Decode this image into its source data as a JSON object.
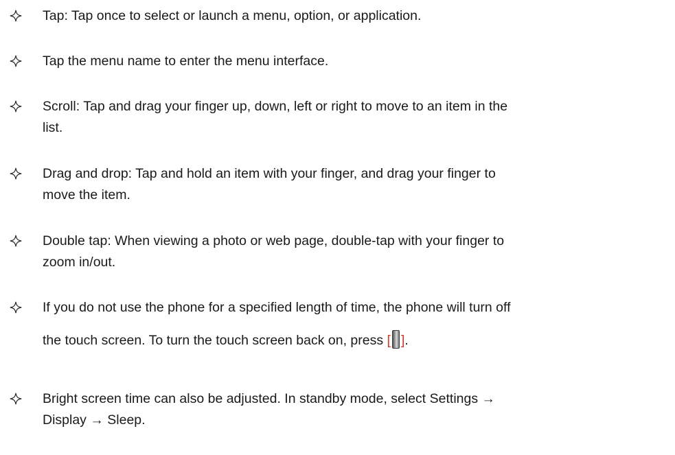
{
  "bullets": [
    {
      "lines": [
        "Tap: Tap once to select or launch a menu, option, or application."
      ]
    },
    {
      "lines": [
        "Tap the menu name to enter the menu interface."
      ]
    },
    {
      "lines": [
        "Scroll: Tap and drag your finger up, down, left or right to move to an item in the",
        "list."
      ]
    },
    {
      "lines": [
        "Drag and drop: Tap and hold an item with your finger, and drag your finger to",
        "move the item."
      ]
    },
    {
      "lines": [
        "Double tap: When viewing a photo or web page, double-tap with your finger to",
        "zoom in/out."
      ]
    },
    {
      "line1": "If you do not use the phone for a specified length of time, the phone will turn off",
      "line2_before": "the touch screen. To turn the touch screen back on, press ",
      "bracket_open": "[",
      "bracket_close": "]",
      "line2_after": "."
    },
    {
      "lines": [
        "Bright screen time can also be adjusted. In standby mode, select Settings →",
        "Display → Sleep."
      ]
    }
  ],
  "icons": {
    "bullet": "four-point-star-outline-icon",
    "key": "power-key-icon"
  },
  "colors": {
    "text": "#1a1a1a",
    "bracket": "#e0301e"
  }
}
